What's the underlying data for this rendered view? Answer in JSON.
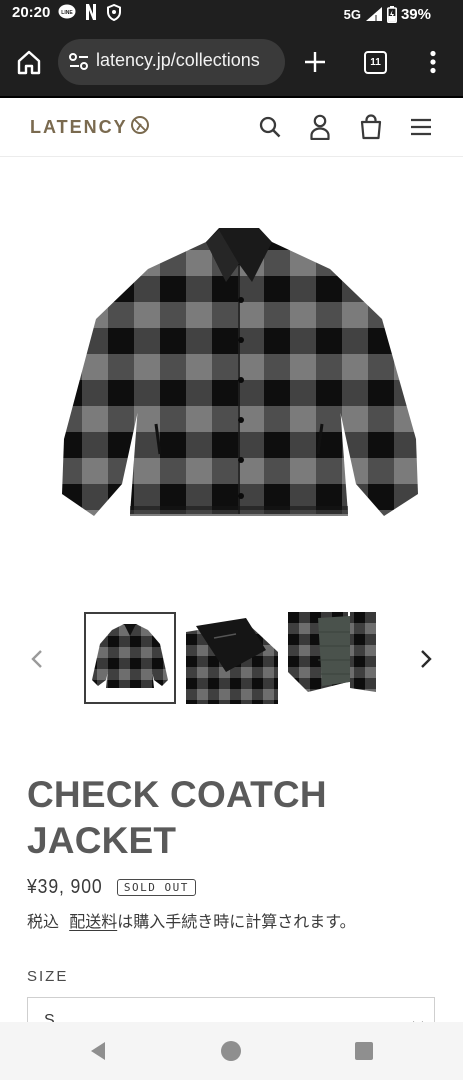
{
  "status_bar": {
    "time": "20:20",
    "network": "5G",
    "battery": "39%",
    "icons": [
      "line-icon",
      "netflix-n-icon",
      "shield-icon",
      "signal-icon",
      "battery-icon"
    ]
  },
  "browser": {
    "url": "latency.jp/collections",
    "tab_count": "11",
    "icons": [
      "home-icon",
      "site-info-icon",
      "new-tab-icon",
      "tab-switcher-icon",
      "more-menu-icon"
    ]
  },
  "site": {
    "logo_text": "LATENCY",
    "header_icons": [
      "search-icon",
      "account-icon",
      "cart-icon",
      "menu-icon"
    ]
  },
  "product": {
    "title": "CHECK COATCH JACKET",
    "price": "¥39, 900",
    "badge": "SOLD OUT",
    "tax_prefix": "税込",
    "shipping_link": "配送料",
    "tax_suffix": "は購入手続き時に計算されます。",
    "size_label": "SIZE",
    "size_value": "S"
  },
  "gallery": {
    "thumbnail_count": 3,
    "active_index": 0
  },
  "colors": {
    "bar_bg": "#1f1f1f",
    "logo": "#7a6a4f",
    "title": "#5a5a5a",
    "text": "#3a3a3a"
  }
}
